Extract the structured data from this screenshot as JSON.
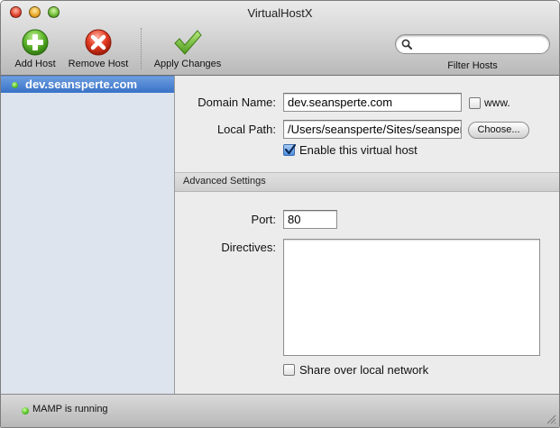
{
  "window": {
    "title": "VirtualHostX"
  },
  "toolbar": {
    "add_label": "Add Host",
    "remove_label": "Remove Host",
    "apply_label": "Apply Changes",
    "filter_label": "Filter Hosts",
    "search_value": "",
    "icons": {
      "add": "plus-icon",
      "remove": "x-icon",
      "apply": "checkmark-icon",
      "search": "magnifier-icon"
    }
  },
  "sidebar": {
    "hosts": [
      {
        "name": "dev.seansperte.com",
        "status": "active"
      }
    ]
  },
  "form": {
    "domain_label": "Domain Name:",
    "domain_value": "dev.seansperte.com",
    "www_label": "www.",
    "www_checked": false,
    "path_label": "Local Path:",
    "path_value": "/Users/seansperte/Sites/seansperte",
    "choose_label": "Choose...",
    "enable_label": "Enable this virtual host",
    "enable_checked": true,
    "advanced_header": "Advanced Settings",
    "port_label": "Port:",
    "port_value": "80",
    "directives_label": "Directives:",
    "directives_value": "",
    "share_label": "Share over local network",
    "share_checked": false
  },
  "status": {
    "text": "MAMP is running",
    "indicator": "green"
  },
  "colors": {
    "selection": "#3872c8",
    "sidebar_bg": "#dde4ee",
    "status_green": "#49b71a"
  }
}
